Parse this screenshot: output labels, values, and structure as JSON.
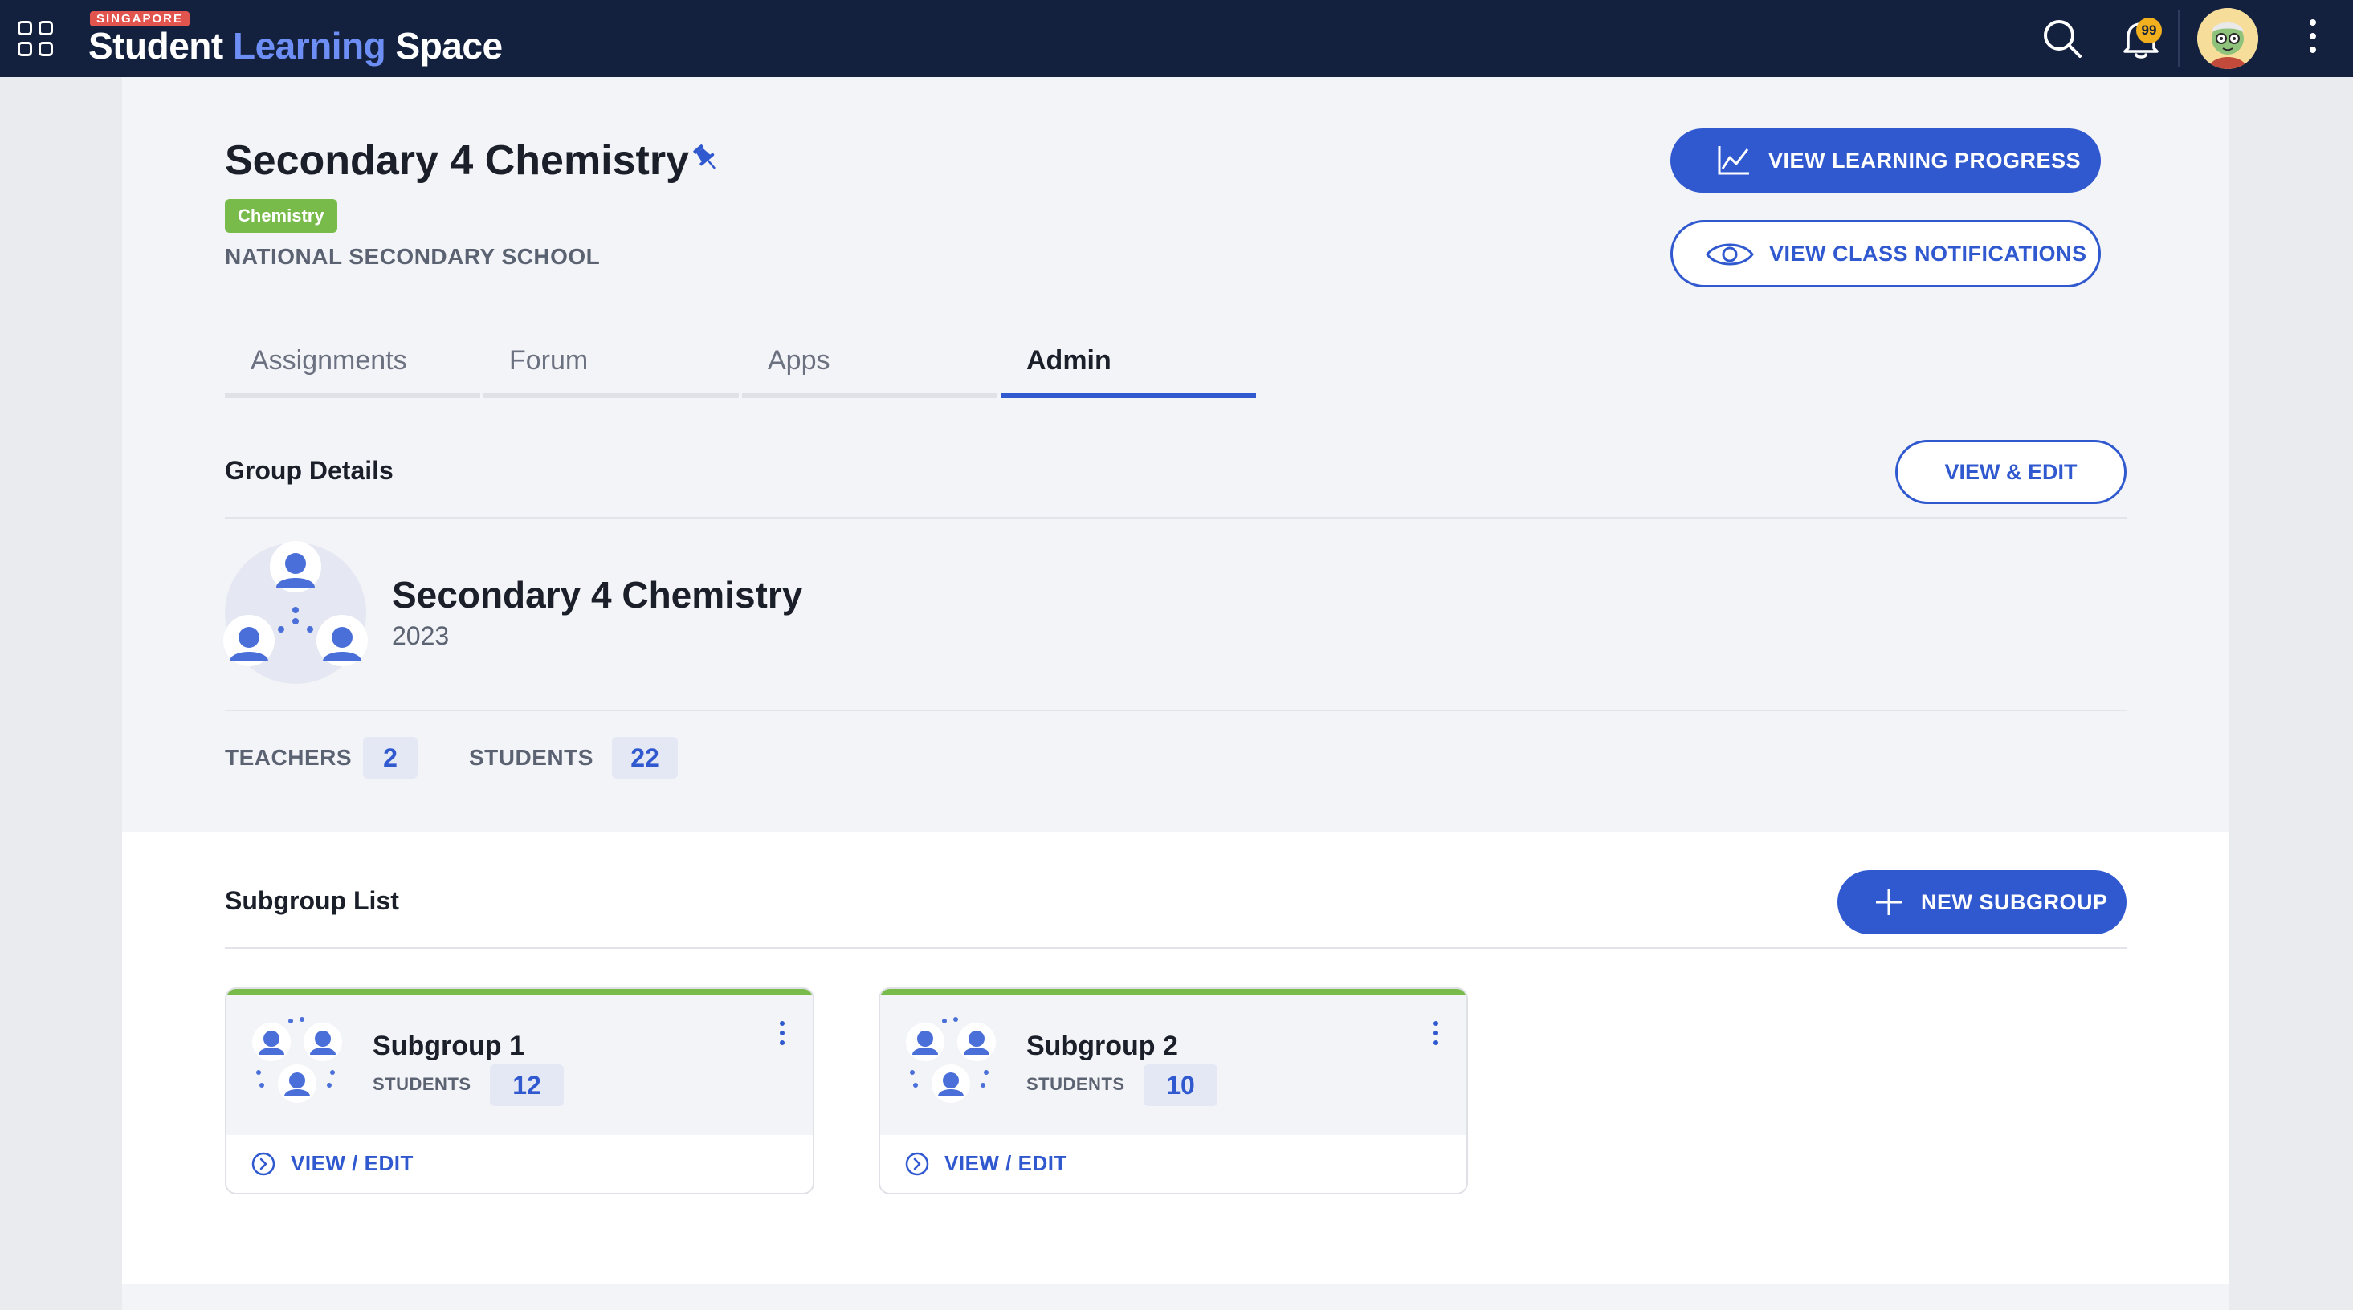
{
  "brand": {
    "tag": "SINGAPORE",
    "word1": "Student",
    "word2": "Learning",
    "word3": "Space"
  },
  "topbar": {
    "notification_count": "99"
  },
  "page": {
    "title": "Secondary 4 Chemistry",
    "subject_badge": "Chemistry",
    "school": "NATIONAL SECONDARY SCHOOL"
  },
  "actions": {
    "view_progress": "VIEW LEARNING PROGRESS",
    "view_notifications": "VIEW CLASS NOTIFICATIONS"
  },
  "tabs": [
    {
      "label": "Assignments",
      "active": false
    },
    {
      "label": "Forum",
      "active": false
    },
    {
      "label": "Apps",
      "active": false
    },
    {
      "label": "Admin",
      "active": true
    }
  ],
  "group_details": {
    "section_title": "Group Details",
    "edit_label": "VIEW & EDIT",
    "name": "Secondary 4 Chemistry",
    "year": "2023",
    "teachers_label": "TEACHERS",
    "teachers_count": "2",
    "students_label": "STUDENTS",
    "students_count": "22"
  },
  "subgroups": {
    "section_title": "Subgroup List",
    "new_label": "NEW SUBGROUP",
    "items": [
      {
        "name": "Subgroup 1",
        "students_label": "STUDENTS",
        "students_count": "12",
        "link_label": "VIEW / EDIT"
      },
      {
        "name": "Subgroup 2",
        "students_label": "STUDENTS",
        "students_count": "10",
        "link_label": "VIEW / EDIT"
      }
    ]
  },
  "colors": {
    "topbar": "#13213f",
    "accent": "#3059cf",
    "brand_highlight": "#6d8ef5",
    "badge_green": "#78bb4b",
    "notification_badge": "#f2b01e"
  },
  "icons": {
    "apps": "apps-grid-icon",
    "search": "search-icon",
    "notifications": "bell-icon",
    "more": "kebab-icon",
    "pin": "pin-icon",
    "progress": "line-chart-icon",
    "notifications_view": "eye-icon",
    "add": "plus-icon",
    "link": "chevron-circle-icon"
  }
}
